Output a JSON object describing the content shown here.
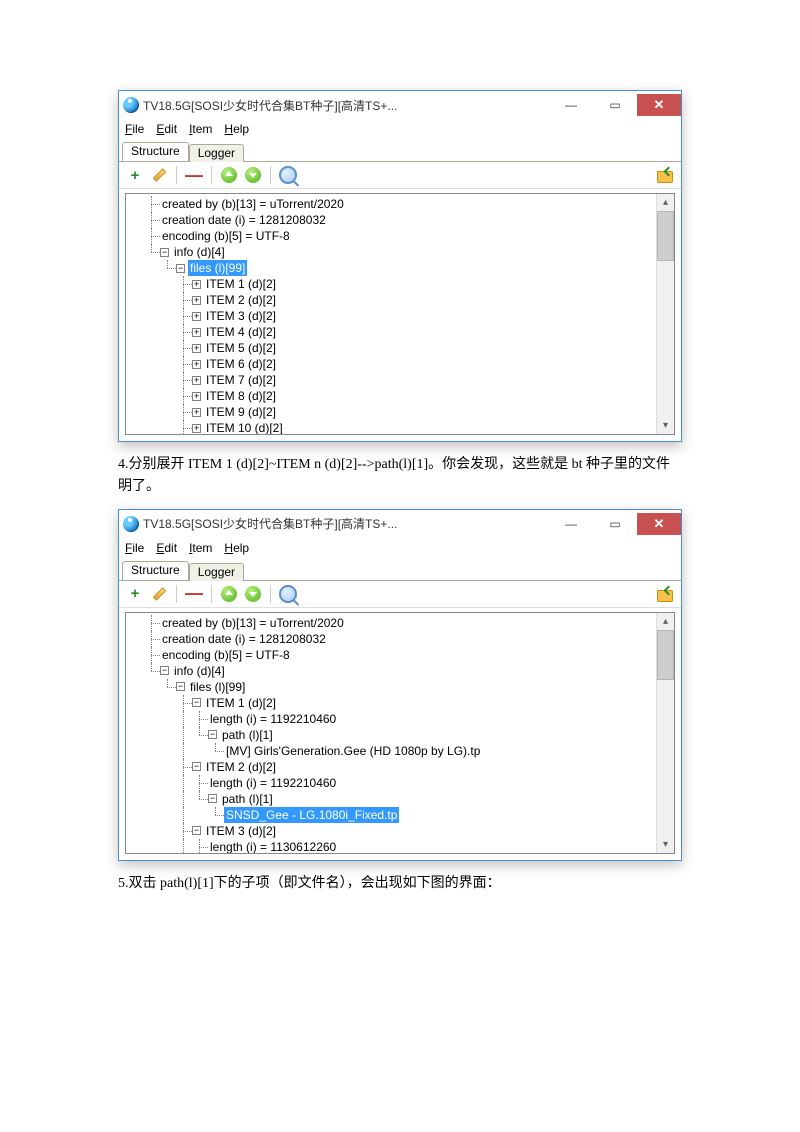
{
  "window": {
    "title": "TV18.5G[SOSI少女时代合集BT种子][高清TS+...",
    "menus": {
      "file": "File",
      "edit": "Edit",
      "item": "Item",
      "help": "Help"
    },
    "tabs": {
      "structure": "Structure",
      "logger": "Logger"
    }
  },
  "tree_common": {
    "created_by": "created by (b)[13] = uTorrent/2020",
    "creation_date": "creation date (i) = 1281208032",
    "encoding": "encoding (b)[5] = UTF-8",
    "info": "info (d)[4]",
    "files": "files (l)[99]"
  },
  "tree1_items": [
    "ITEM 1 (d)[2]",
    "ITEM 2 (d)[2]",
    "ITEM 3 (d)[2]",
    "ITEM 4 (d)[2]",
    "ITEM 5 (d)[2]",
    "ITEM 6 (d)[2]",
    "ITEM 7 (d)[2]",
    "ITEM 8 (d)[2]",
    "ITEM 9 (d)[2]",
    "ITEM 10 (d)[2]"
  ],
  "tree2": {
    "item1": "ITEM 1 (d)[2]",
    "item1_length": "length (i) = 1192210460",
    "item1_path": "path (l)[1]",
    "item1_file": "[MV] Girls'Generation.Gee (HD 1080p by LG).tp",
    "item2": "ITEM 2 (d)[2]",
    "item2_length": "length (i) = 1192210460",
    "item2_path": "path (l)[1]",
    "item2_file": "SNSD_Gee - LG.1080i_Fixed.tp",
    "item3": "ITEM 3 (d)[2]",
    "item3_length": "length (i) = 1130612260"
  },
  "article": {
    "p4": "4.分别展开 ITEM 1 (d)[2]~ITEM n (d)[2]-->path(l)[1]。你会发现，这些就是 bt 种子里的文件明了。",
    "p5": "5.双击 path(l)[1]下的子项（即文件名），会出现如下图的界面："
  }
}
